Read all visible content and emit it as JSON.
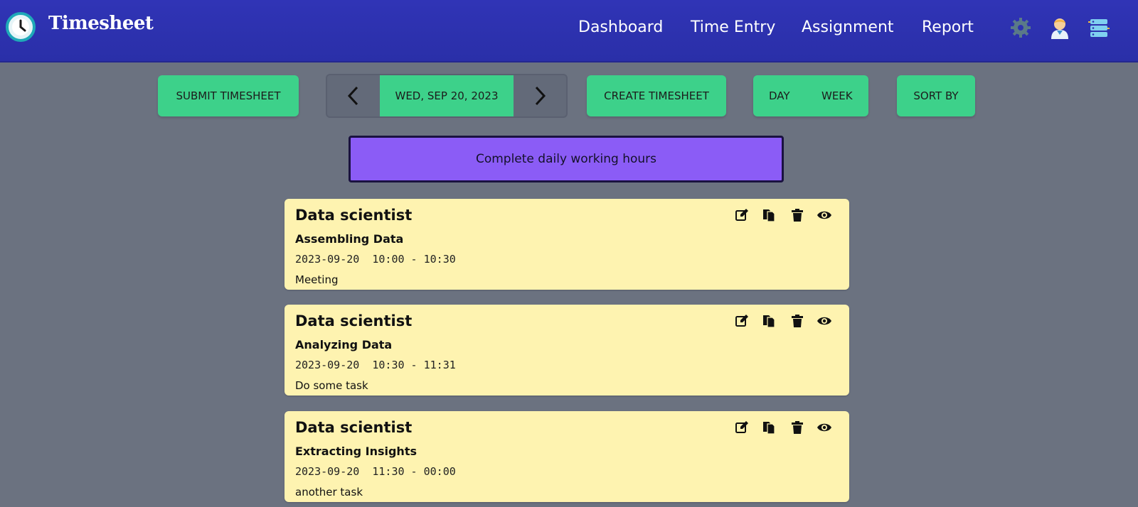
{
  "header": {
    "brand": "Timesheet",
    "nav": [
      "Dashboard",
      "Time Entry",
      "Assignment",
      "Report"
    ],
    "icons": [
      "settings-icon",
      "user-avatar-icon",
      "database-icon"
    ]
  },
  "toolbar": {
    "submit_label": "SUBMIT TIMESHEET",
    "date_label": "WED, SEP 20, 2023",
    "create_label": "CREATE TIMESHEET",
    "view_day": "DAY",
    "view_week": "WEEK",
    "sort_label": "SORT BY"
  },
  "banner": {
    "text": "Complete daily working hours"
  },
  "entries": [
    {
      "role": "Data scientist",
      "task": "Assembling Data",
      "date": "2023-09-20",
      "time": "10:00 - 10:30",
      "note": "Meeting"
    },
    {
      "role": "Data scientist",
      "task": "Analyzing Data",
      "date": "2023-09-20",
      "time": "10:30 - 11:31",
      "note": "Do some task"
    },
    {
      "role": "Data scientist",
      "task": "Extracting Insights",
      "date": "2023-09-20",
      "time": "11:30 - 00:00",
      "note": "another task"
    }
  ],
  "colors": {
    "header": "#2e32b0",
    "accent": "#3dd18a",
    "banner": "#8b5cf6",
    "card": "#fef3b0",
    "background": "#6b7280"
  }
}
